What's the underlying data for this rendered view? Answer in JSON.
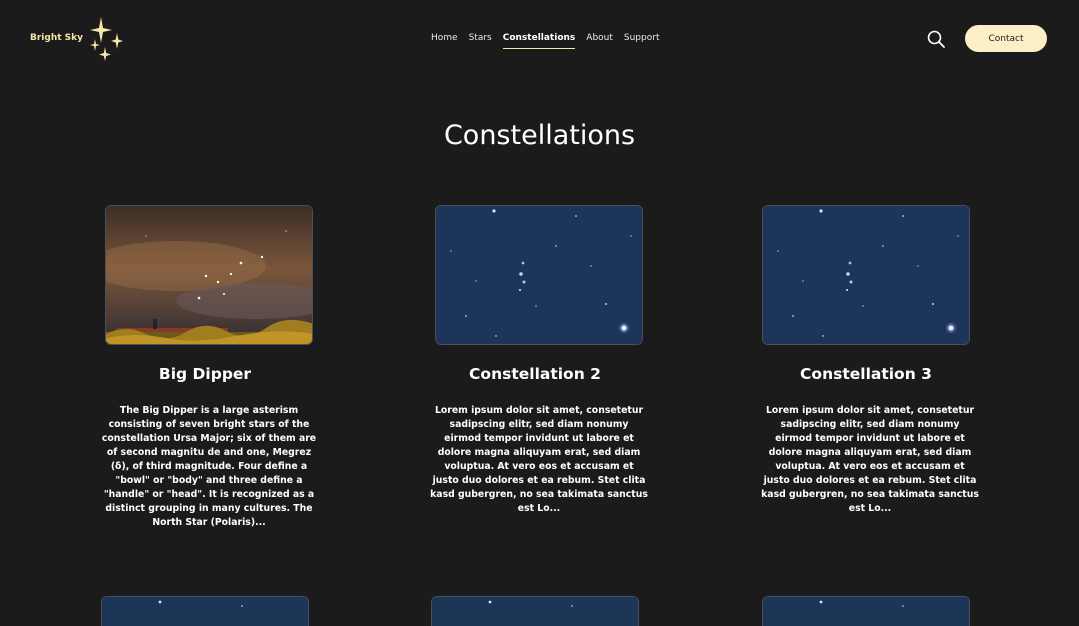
{
  "brand": {
    "name": "Bright Sky",
    "logo_icon": "sparkle-stars-icon",
    "color": "#f6e7a8"
  },
  "nav": {
    "items": [
      {
        "label": "Home",
        "active": false
      },
      {
        "label": "Stars",
        "active": false
      },
      {
        "label": "Constellations",
        "active": true
      },
      {
        "label": "About",
        "active": false
      },
      {
        "label": "Support",
        "active": false
      }
    ]
  },
  "header": {
    "search_icon": "search-icon",
    "contact_label": "Contact",
    "contact_bg": "#fcefc7"
  },
  "page": {
    "title": "Constellations",
    "background": "#1c1b1b"
  },
  "cards": [
    {
      "title": "Big Dipper",
      "image": "big-dipper-photo",
      "description": "The Big Dipper is a large asterism consisting of seven bright stars of the constellation Ursa Major; six of them are of second magnitu de and one, Megrez (δ), of third magnitude. Four define a \"bowl\" or \"body\" and three define a \"handle\" or \"head\". It is recognized as a distinct grouping in many cultures. The North Star (Polaris)..."
    },
    {
      "title": "Constellation 2",
      "image": "orion-starfield-photo",
      "description": "Lorem ipsum dolor sit amet, consetetur sadipscing elitr, sed diam nonumy eirmod tempor invidunt ut labore et dolore magna aliquyam erat, sed diam voluptua. At vero eos et accusam et justo duo dolores et ea rebum. Stet clita kasd gubergren, no sea takimata sanctus est Lo..."
    },
    {
      "title": "Constellation 3",
      "image": "orion-starfield-photo",
      "description": "Lorem ipsum dolor sit amet, consetetur sadipscing elitr, sed diam nonumy eirmod tempor invidunt ut labore et dolore magna aliquyam erat, sed diam voluptua. At vero eos et accusam et justo duo dolores et ea rebum. Stet clita kasd gubergren, no sea takimata sanctus est Lo..."
    }
  ]
}
